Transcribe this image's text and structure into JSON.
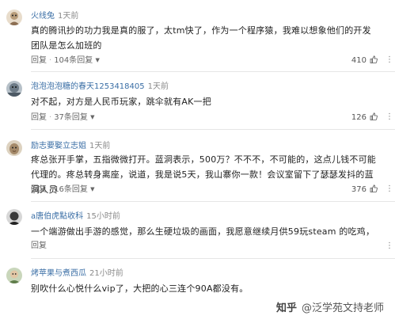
{
  "comments": [
    {
      "username": "火线兔",
      "time": "1天前",
      "text": "真的腾讯抄的功力我是真的服了，太tm快了，作为一个程序猿，我难以想象他们的开发团队是怎么加班的",
      "reply_label": "回复",
      "replies_label": "104条回复",
      "likes": "410",
      "avatar_color": "#c9b9a6"
    },
    {
      "username": "泡泡泡泡糖的春天1253418405",
      "time": "1天前",
      "text": "对不起，对方是人民币玩家，跳伞就有AK一把",
      "reply_label": "回复",
      "replies_label": "37条回复",
      "likes": "126",
      "avatar_color": "#8f9aa3"
    },
    {
      "username": "励志要娶立志姐",
      "time": "1天前",
      "text": "疼总张开手掌，五指微微打开。蓝洞表示，500万？不不不，不可能的，这点儿钱不可能代理的。疼总转身离座，说道，我是说5天，我山寨你一款！会议室留下了瑟瑟发抖的蓝洞人员",
      "reply_label": "回复",
      "replies_label": "16条回复",
      "likes": "376",
      "avatar_color": "#b7a58c"
    },
    {
      "username": "a唐伯虎點收科",
      "time": "15小时前",
      "text": "一个端游做出手游的感觉，那么生硬垃圾的画面，我愿意继续月供59玩steam 的吃鸡，",
      "reply_label": "回复",
      "replies_label": "",
      "likes": "",
      "avatar_color": "#6e6e6e"
    },
    {
      "username": "烤苹果与煮西瓜",
      "time": "21小时前",
      "text": "别吹什么心悦什么vip了，大把的心三连个90A都没有。",
      "reply_label": "",
      "replies_label": "",
      "likes": "",
      "avatar_color": "#7f9a6b"
    }
  ],
  "watermark": {
    "site": "知乎",
    "author": "@泛学苑文持老师"
  },
  "colors": {
    "username": "#3a6ea5",
    "meta": "#8a8a8a",
    "text": "#222222"
  }
}
